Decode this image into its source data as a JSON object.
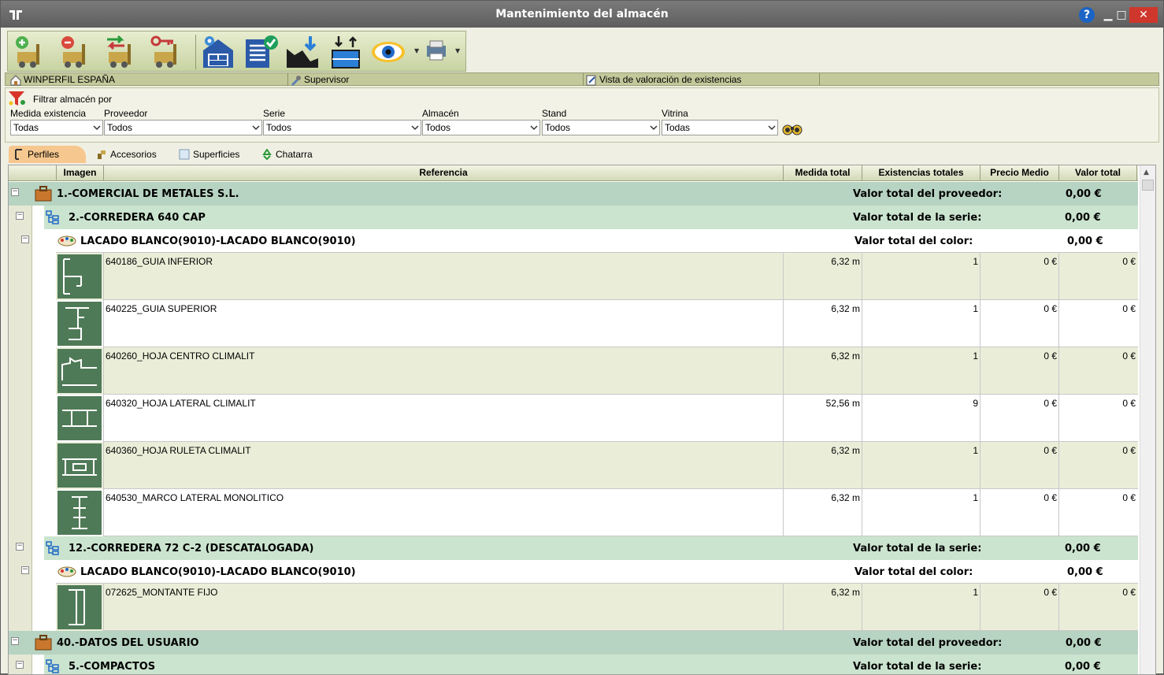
{
  "window": {
    "title": "Mantenimiento del almacén",
    "help": "?",
    "minimize": "▁",
    "maximize": "□",
    "close": "✕"
  },
  "infobar": {
    "company": "WINPERFIL ESPAÑA",
    "user": "Supervisor",
    "view": "Vista de valoración de existencias"
  },
  "filters": {
    "heading": "Filtrar almacén por",
    "fields": [
      {
        "label": "Medida existencia",
        "value": "Todas"
      },
      {
        "label": "Proveedor",
        "value": "Todos"
      },
      {
        "label": "Serie",
        "value": "Todos"
      },
      {
        "label": "Almacén",
        "value": "Todos"
      },
      {
        "label": "Stand",
        "value": "Todos"
      },
      {
        "label": "Vitrina",
        "value": "Todas"
      }
    ]
  },
  "tabs": [
    {
      "label": "Perfiles",
      "icon": "profile-icon"
    },
    {
      "label": "Accesorios",
      "icon": "accessory-icon"
    },
    {
      "label": "Superficies",
      "icon": "surface-icon"
    },
    {
      "label": "Chatarra",
      "icon": "recycle-icon"
    }
  ],
  "columns": {
    "imagen": "Imagen",
    "referencia": "Referencia",
    "medida": "Medida total",
    "existencias": "Existencias totales",
    "precio": "Precio Medio",
    "valor": "Valor total"
  },
  "groups": {
    "prov1": {
      "name": "1.-COMERCIAL DE METALES S.L.",
      "label": "Valor total del proveedor:",
      "value": "0,00 €"
    },
    "serie1": {
      "name": "2.-CORREDERA 640 CAP",
      "label": "Valor total de la serie:",
      "value": "0,00 €"
    },
    "color1": {
      "name": "LACADO BLANCO(9010)-LACADO BLANCO(9010)",
      "label": "Valor total del color:",
      "value": "0,00 €"
    },
    "serie2": {
      "name": "12.-CORREDERA 72 C-2 (DESCATALOGADA)",
      "label": "Valor total de la serie:",
      "value": "0,00 €"
    },
    "color2": {
      "name": "LACADO BLANCO(9010)-LACADO BLANCO(9010)",
      "label": "Valor total del color:",
      "value": "0,00 €"
    },
    "prov2": {
      "name": "40.-DATOS DEL USUARIO",
      "label": "Valor total del proveedor:",
      "value": "0,00 €"
    },
    "serie3": {
      "name": "5.-COMPACTOS",
      "label": "Valor total de la serie:",
      "value": "0,00 €"
    }
  },
  "items": [
    {
      "ref": "640186_GUIA INFERIOR",
      "medida": "6,32 m",
      "existencias": "1",
      "precio": "0 €",
      "valor": "0 €"
    },
    {
      "ref": "640225_GUIA SUPERIOR",
      "medida": "6,32 m",
      "existencias": "1",
      "precio": "0 €",
      "valor": "0 €"
    },
    {
      "ref": "640260_HOJA CENTRO CLIMALIT",
      "medida": "6,32 m",
      "existencias": "1",
      "precio": "0 €",
      "valor": "0 €"
    },
    {
      "ref": "640320_HOJA LATERAL CLIMALIT",
      "medida": "52,56 m",
      "existencias": "9",
      "precio": "0 €",
      "valor": "0 €"
    },
    {
      "ref": "640360_HOJA RULETA CLIMALIT",
      "medida": "6,32 m",
      "existencias": "1",
      "precio": "0 €",
      "valor": "0 €"
    },
    {
      "ref": "640530_MARCO LATERAL MONOLITICO",
      "medida": "6,32 m",
      "existencias": "1",
      "precio": "0 €",
      "valor": "0 €"
    },
    {
      "ref": "072625_MONTANTE FIJO",
      "medida": "6,32 m",
      "existencias": "1",
      "precio": "0 €",
      "valor": "0 €"
    }
  ],
  "colors": {
    "accent_tab": "#f6c78e",
    "toolbar": "#c8d3a2",
    "group_provider": "#b7d3c1",
    "group_series": "#cbe4cf",
    "thumbnail": "#4f7a57"
  }
}
